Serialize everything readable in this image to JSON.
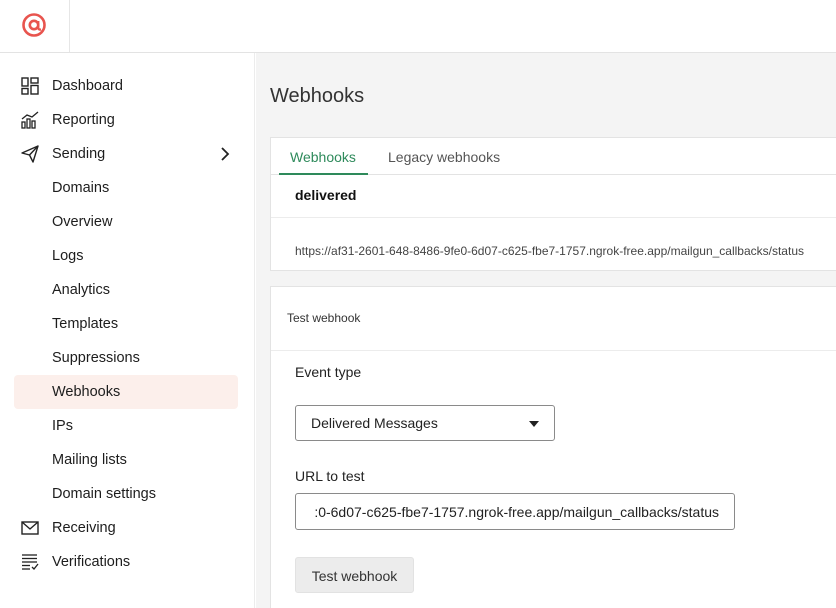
{
  "brand": {
    "logo_icon": "at-sign-icon",
    "accent": "#e8544e"
  },
  "sidebar": {
    "items": [
      {
        "label": "Dashboard",
        "icon": "dashboard-icon"
      },
      {
        "label": "Reporting",
        "icon": "chart-icon"
      },
      {
        "label": "Sending",
        "icon": "paper-plane-icon"
      },
      {
        "label": "Domains"
      },
      {
        "label": "Overview"
      },
      {
        "label": "Logs"
      },
      {
        "label": "Analytics"
      },
      {
        "label": "Templates"
      },
      {
        "label": "Suppressions"
      },
      {
        "label": "Webhooks",
        "active": true
      },
      {
        "label": "IPs"
      },
      {
        "label": "Mailing lists"
      },
      {
        "label": "Domain settings"
      },
      {
        "label": "Receiving",
        "icon": "envelope-icon"
      },
      {
        "label": "Verifications",
        "icon": "list-check-icon"
      }
    ]
  },
  "main": {
    "title": "Webhooks",
    "tabs": [
      {
        "label": "Webhooks",
        "active": true
      },
      {
        "label": "Legacy webhooks"
      }
    ],
    "webhook": {
      "event": "delivered",
      "url": "https://af31-2601-648-8486-9fe0-6d07-c625-fbe7-1757.ngrok-free.app/mailgun_callbacks/status"
    },
    "test": {
      "title": "Test webhook",
      "event_type_label": "Event type",
      "event_type_value": "Delivered Messages",
      "url_label": "URL to test",
      "url_value": ":0-6d07-c625-fbe7-1757.ngrok-free.app/mailgun_callbacks/status",
      "button_label": "Test webhook"
    }
  },
  "colors": {
    "active_tab": "#2e8a5b",
    "active_nav_bg": "#fcefeb"
  }
}
